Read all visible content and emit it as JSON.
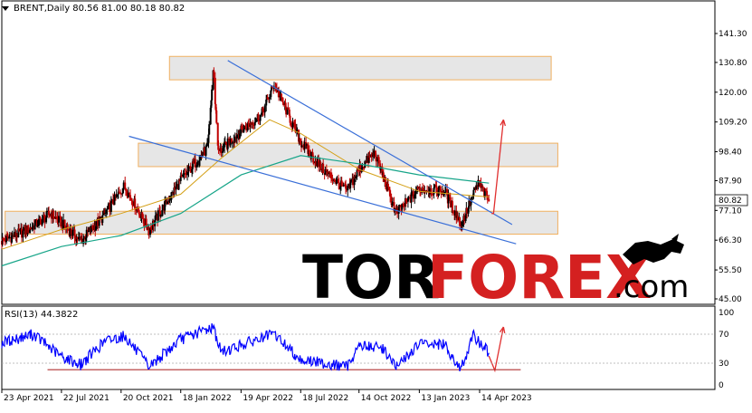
{
  "header": {
    "symbol": "BRENT,Daily",
    "ohlc": "80.56 81.00 80.18 80.82"
  },
  "rsi": {
    "label": "RSI(13) 44.3822"
  },
  "price_badge": "80.82",
  "watermark": {
    "part1": "TOR",
    "part2": "FOREX",
    "part3": ".com"
  },
  "colors": {
    "up": "#000000",
    "down": "#c00000",
    "ma_fast": "#d4a017",
    "ma_slow": "#17a589",
    "trend": "#3a6fd8",
    "zone_fill": "#e6e6e6",
    "zone_border": "#f0b060",
    "arrow": "#e03030",
    "rsi": "#0000ff",
    "support": "#b03030"
  },
  "chart_data": [
    {
      "type": "candlestick",
      "title": "BRENT,Daily",
      "y_ticks": [
        "141.30",
        "130.80",
        "120.00",
        "109.20",
        "98.40",
        "87.90",
        "77.10",
        "66.30",
        "55.50",
        "45.00"
      ],
      "x_ticks": [
        "23 Apr 2021",
        "22 Jul 2021",
        "20 Oct 2021",
        "18 Jan 2022",
        "19 Apr 2022",
        "18 Jul 2022",
        "14 Oct 2022",
        "13 Jan 2023",
        "14 Apr 2023"
      ],
      "ylim": [
        45,
        141.3
      ],
      "last_close": 80.82,
      "close_path": [
        [
          "2021-04-23",
          66
        ],
        [
          "2021-06-01",
          70
        ],
        [
          "2021-07-06",
          76
        ],
        [
          "2021-08-20",
          66
        ],
        [
          "2021-09-20",
          74
        ],
        [
          "2021-10-25",
          86
        ],
        [
          "2021-12-01",
          70
        ],
        [
          "2022-01-18",
          88
        ],
        [
          "2022-02-28",
          100
        ],
        [
          "2022-03-08",
          128
        ],
        [
          "2022-03-16",
          98
        ],
        [
          "2022-04-19",
          106
        ],
        [
          "2022-05-20",
          112
        ],
        [
          "2022-06-08",
          123
        ],
        [
          "2022-07-18",
          102
        ],
        [
          "2022-08-16",
          93
        ],
        [
          "2022-09-26",
          84
        ],
        [
          "2022-10-14",
          92
        ],
        [
          "2022-11-07",
          98
        ],
        [
          "2022-12-09",
          76
        ],
        [
          "2023-01-13",
          85
        ],
        [
          "2023-02-20",
          84
        ],
        [
          "2023-03-17",
          72
        ],
        [
          "2023-04-12",
          87
        ],
        [
          "2023-04-28",
          80.8
        ]
      ],
      "ma_fast_path": [
        [
          "2021-04-23",
          63
        ],
        [
          "2021-07-20",
          70
        ],
        [
          "2021-10-20",
          76
        ],
        [
          "2022-01-18",
          83
        ],
        [
          "2022-03-20",
          96
        ],
        [
          "2022-06-01",
          110
        ],
        [
          "2022-07-18",
          105
        ],
        [
          "2022-10-14",
          92
        ],
        [
          "2023-01-13",
          84
        ],
        [
          "2023-04-28",
          82
        ]
      ],
      "ma_slow_path": [
        [
          "2021-04-23",
          57
        ],
        [
          "2021-07-22",
          64
        ],
        [
          "2021-10-20",
          68
        ],
        [
          "2022-01-18",
          76
        ],
        [
          "2022-04-19",
          90
        ],
        [
          "2022-07-18",
          97
        ],
        [
          "2022-10-14",
          94
        ],
        [
          "2023-01-13",
          90
        ],
        [
          "2023-04-28",
          87
        ]
      ],
      "zones": [
        {
          "from": "2022-01-01",
          "to": "2023-07-31",
          "y_low": 124.5,
          "y_high": 133
        },
        {
          "from": "2021-11-15",
          "to": "2023-08-10",
          "y_low": 93,
          "y_high": 101.5
        },
        {
          "from": "2021-04-28",
          "to": "2023-08-10",
          "y_low": 68.5,
          "y_high": 76.8
        }
      ],
      "trendlines": [
        {
          "from": [
            "2022-03-30",
            131.5
          ],
          "to": [
            "2023-06-02",
            72
          ]
        },
        {
          "from": [
            "2021-11-01",
            104
          ],
          "to": [
            "2023-06-08",
            65
          ]
        }
      ],
      "forecast_arrows": [
        {
          "from": [
            "2023-05-02",
            76
          ],
          "via": [
            "2023-05-05",
            76
          ],
          "to": [
            "2023-05-20",
            110
          ]
        }
      ]
    },
    {
      "type": "line",
      "title": "RSI(13) 44.3822",
      "y_ticks": [
        "100",
        "70",
        "30",
        "0"
      ],
      "ylim": [
        0,
        100
      ],
      "last_value": 44.3822,
      "support_level": 21,
      "rsi_path": [
        [
          "2021-04-23",
          58
        ],
        [
          "2021-06-10",
          70
        ],
        [
          "2021-07-20",
          40
        ],
        [
          "2021-08-20",
          28
        ],
        [
          "2021-09-25",
          60
        ],
        [
          "2021-10-25",
          68
        ],
        [
          "2021-12-01",
          25
        ],
        [
          "2022-01-18",
          63
        ],
        [
          "2022-03-08",
          80
        ],
        [
          "2022-03-20",
          45
        ],
        [
          "2022-04-19",
          55
        ],
        [
          "2022-06-08",
          70
        ],
        [
          "2022-07-18",
          35
        ],
        [
          "2022-09-26",
          25
        ],
        [
          "2022-10-14",
          55
        ],
        [
          "2022-11-20",
          50
        ],
        [
          "2022-12-09",
          24
        ],
        [
          "2023-01-13",
          57
        ],
        [
          "2023-02-20",
          55
        ],
        [
          "2023-03-17",
          22
        ],
        [
          "2023-04-05",
          68
        ],
        [
          "2023-04-28",
          44
        ]
      ],
      "forecast_arrows": [
        {
          "from": [
            "2023-04-28",
            40
          ],
          "via": [
            "2023-05-07",
            20
          ],
          "to": [
            "2023-05-20",
            80
          ]
        }
      ]
    }
  ]
}
